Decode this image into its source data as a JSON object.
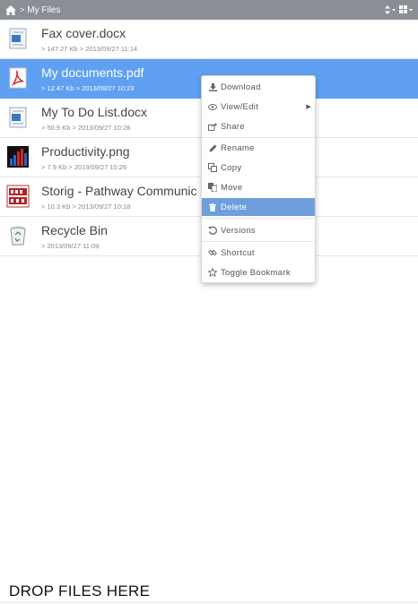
{
  "header": {
    "breadcrumb_sep": ">",
    "title": "My Files",
    "sort_icon": "sort-icon",
    "view_icon": "grid-view-icon"
  },
  "files": [
    {
      "name": "Fax cover.docx",
      "size": "147.27 Kb",
      "date": "2013/09/27 11:14",
      "icon": "word-doc-icon"
    },
    {
      "name": "My documents.pdf",
      "size": "12.47 Kb",
      "date": "2013/09/27 10:23",
      "icon": "pdf-icon"
    },
    {
      "name": "My To Do List.docx",
      "size": "50.9 Kb",
      "date": "2013/09/27 10:28",
      "icon": "word-doc-icon"
    },
    {
      "name": "Productivity.png",
      "size": "7.9 Kb",
      "date": "2013/09/27 10:26",
      "icon": "image-chart-icon"
    },
    {
      "name": "Storig - Pathway Communic",
      "size": "10.3 Kb",
      "date": "2013/09/27 10:18",
      "icon": "storig-logo-icon"
    },
    {
      "name": "Recycle Bin",
      "size": "",
      "date": "2013/09/27 11:09",
      "icon": "recycle-bin-icon"
    }
  ],
  "meta_sep": ">",
  "context_menu": {
    "download": "Download",
    "view_edit": "View/Edit",
    "share": "Share",
    "rename": "Rename",
    "copy": "Copy",
    "move": "Move",
    "delete": "Delete",
    "versions": "Versions",
    "shortcut": "Shortcut",
    "toggle_bookmark": "Toggle Bookmark"
  },
  "colors": {
    "topbar": "#8a8f95",
    "selected_row": "#5fa0f3",
    "menu_active": "#6e9fdc"
  },
  "drop_zone": {
    "label": "DROP FILES HERE"
  }
}
